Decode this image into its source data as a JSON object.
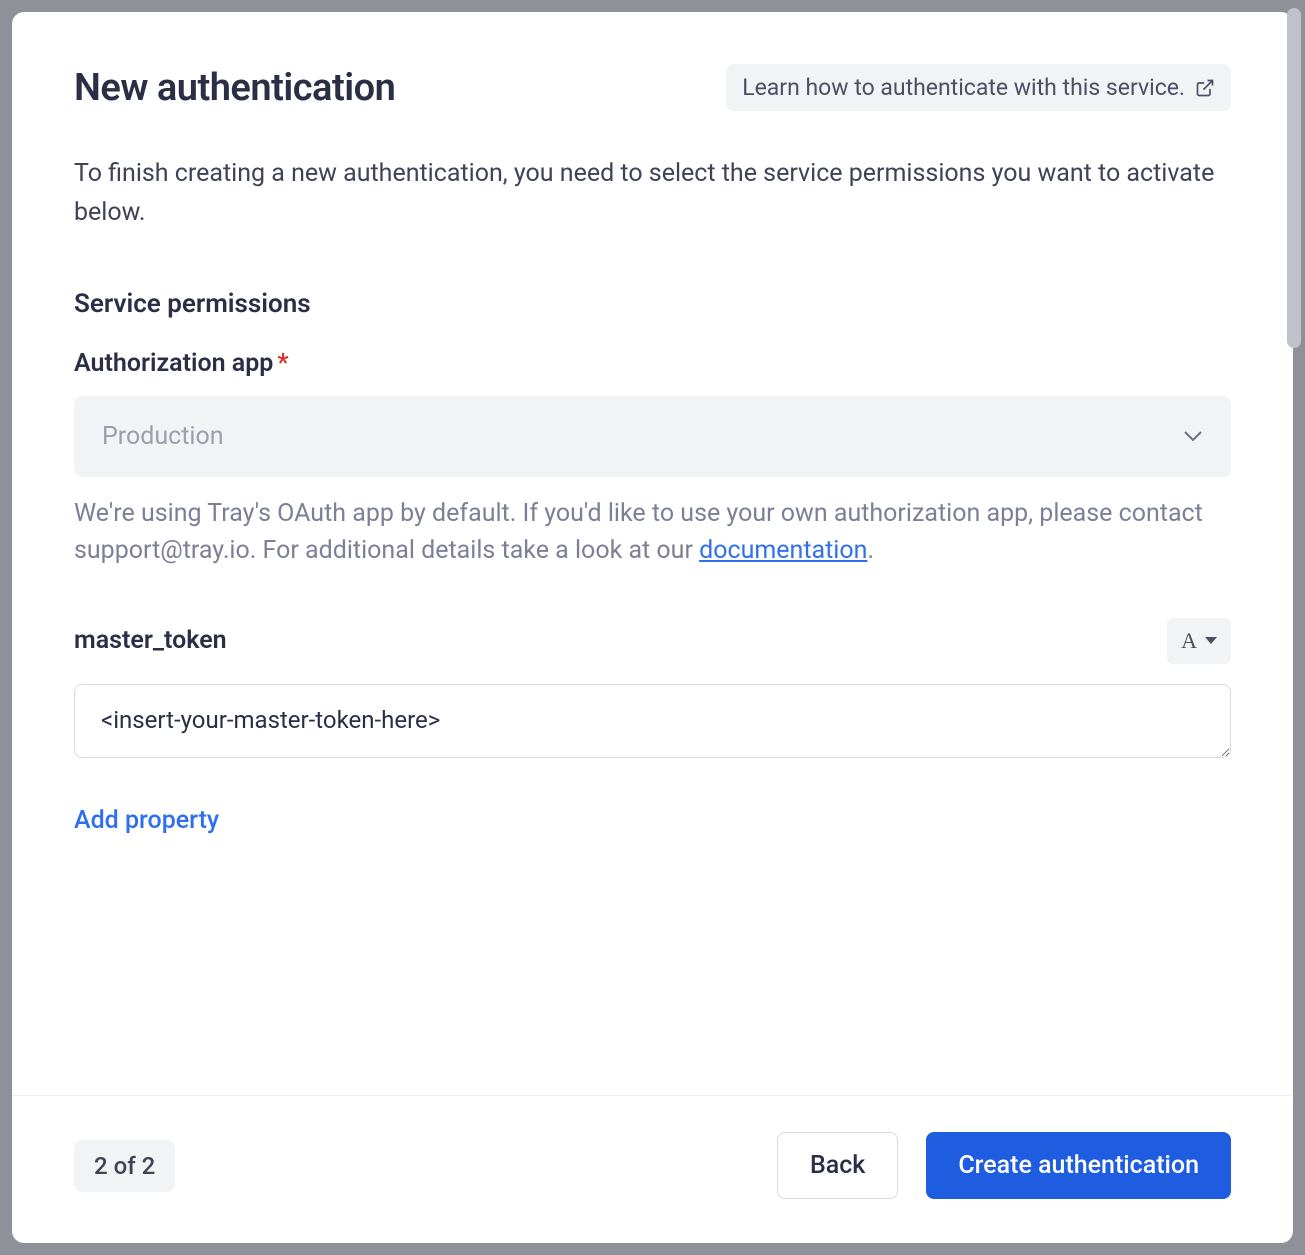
{
  "header": {
    "title": "New authentication",
    "learn_link_label": "Learn how to authenticate with this service."
  },
  "intro": "To finish creating a new authentication, you need to select the service permissions you want to activate below.",
  "section": {
    "heading": "Service permissions"
  },
  "auth_app": {
    "label": "Authorization app",
    "required_mark": "*",
    "selected": "Production",
    "helper_prefix": "We're using Tray's OAuth app by default. If you'd like to use your own authorization app, please contact support@tray.io. For additional details take a look at our ",
    "helper_link": "documentation",
    "helper_suffix": "."
  },
  "master_token": {
    "label": "master_token",
    "type_badge": "A",
    "value": "<insert-your-master-token-here>"
  },
  "add_property_label": "Add property",
  "footer": {
    "step": "2 of 2",
    "back_label": "Back",
    "create_label": "Create authentication"
  }
}
